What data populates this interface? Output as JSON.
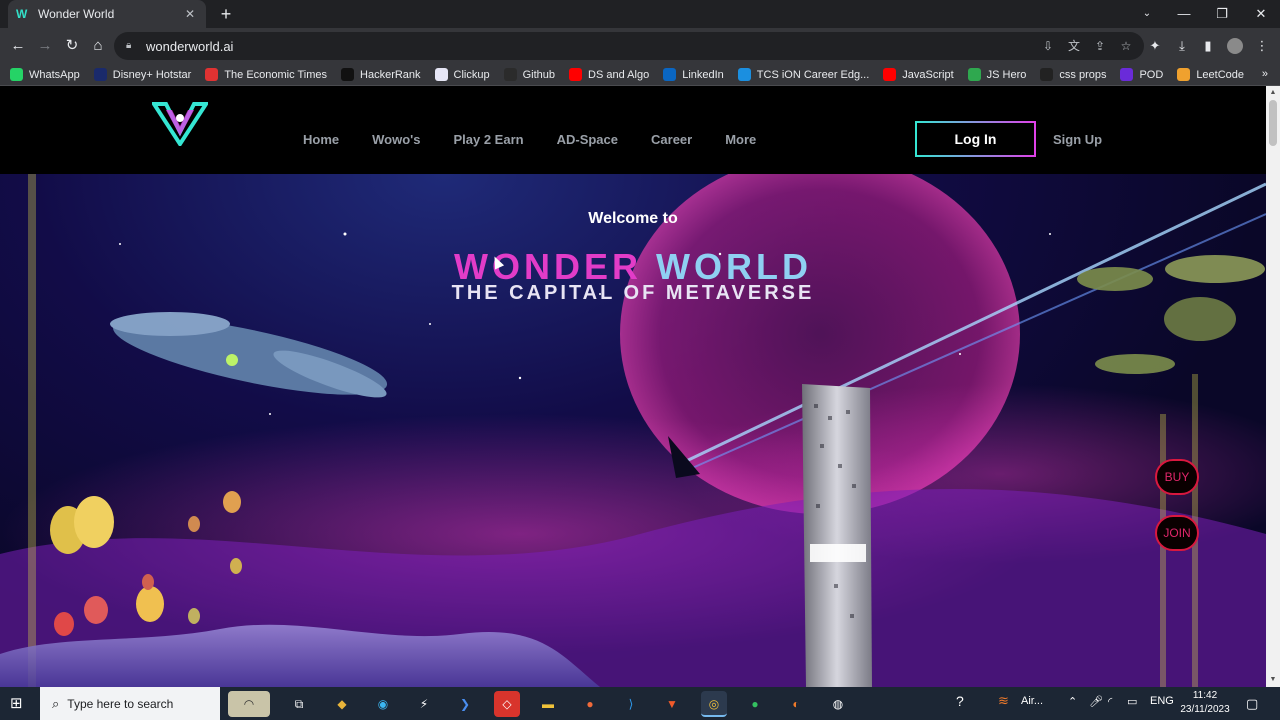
{
  "browser": {
    "tab": {
      "title": "Wonder World",
      "favicon": "wonderworld-logo-icon"
    },
    "url": "wonderworld.ai",
    "bookmarks": [
      {
        "label": "WhatsApp",
        "icon": "whatsapp-icon",
        "color": "#25d366"
      },
      {
        "label": "Disney+ Hotstar",
        "icon": "hotstar-icon",
        "color": "#1a2a6b"
      },
      {
        "label": "The Economic Times",
        "icon": "et-icon",
        "color": "#e03232"
      },
      {
        "label": "HackerRank",
        "icon": "hackerrank-icon",
        "color": "#111111"
      },
      {
        "label": "Clickup",
        "icon": "clickup-icon",
        "color": "#e6e6f5"
      },
      {
        "label": "Github",
        "icon": "github-icon",
        "color": "#2b2b2b"
      },
      {
        "label": "DS and Algo",
        "icon": "youtube-icon",
        "color": "#ff0000"
      },
      {
        "label": "LinkedIn",
        "icon": "linkedin-icon",
        "color": "#0a66c2"
      },
      {
        "label": "TCS iON Career Edg...",
        "icon": "tcs-icon",
        "color": "#1b8fe0"
      },
      {
        "label": "JavaScript",
        "icon": "youtube-icon",
        "color": "#ff0000"
      },
      {
        "label": "JS Hero",
        "icon": "jshero-icon",
        "color": "#2fa84f"
      },
      {
        "label": "css props",
        "icon": "css-icon",
        "color": "#222222"
      },
      {
        "label": "POD",
        "icon": "pod-icon",
        "color": "#6a2bd9"
      },
      {
        "label": "LeetCode",
        "icon": "leetcode-icon",
        "color": "#f0a12e"
      }
    ]
  },
  "site": {
    "nav": [
      "Home",
      "Wowo's",
      "Play 2 Earn",
      "AD-Space",
      "Career",
      "More"
    ],
    "login_label": "Log In",
    "signup_label": "Sign Up",
    "hero": {
      "welcome": "Welcome to",
      "title_word1": "WONDER",
      "title_word2": "WORLD",
      "subtitle": "THE CAPITAL OF METAVERSE"
    },
    "buy_label": "BUY",
    "join_label": "JOIN"
  },
  "taskbar": {
    "search_placeholder": "Type here to search",
    "weather_label": "Air...",
    "language": "ENG",
    "time": "11:42",
    "date": "23/11/2023"
  },
  "colors": {
    "accent_teal": "#35e6d3",
    "accent_magenta": "#e040e8",
    "side_button_border": "#d9183f"
  }
}
